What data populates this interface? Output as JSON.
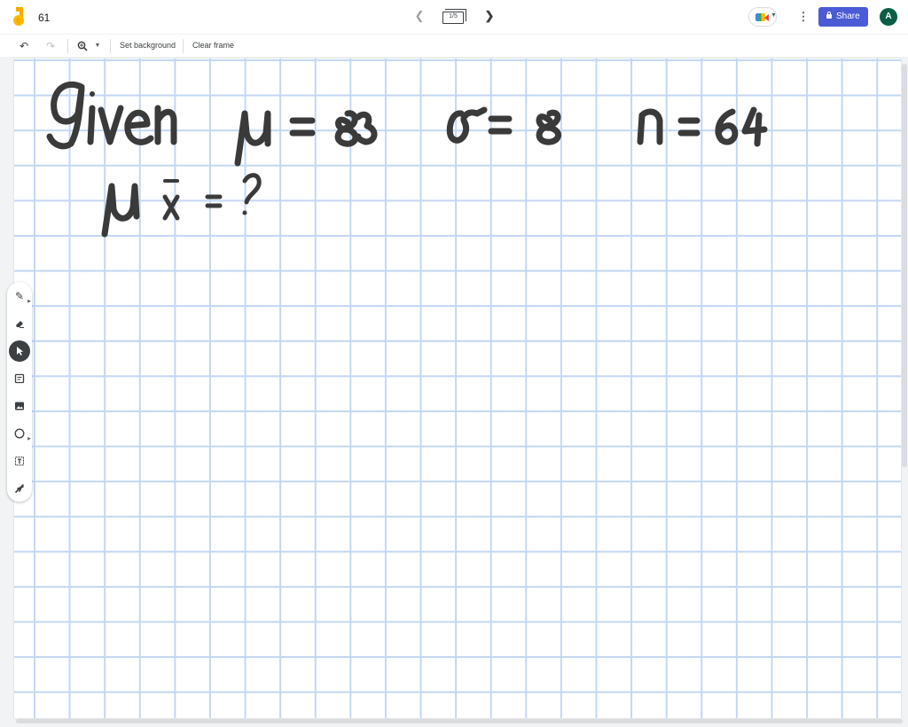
{
  "header": {
    "title": "61",
    "frame_counter": "1/5",
    "share_label": "Share",
    "avatar_initial": "A"
  },
  "toolbar": {
    "set_background_label": "Set background",
    "clear_frame_label": "Clear frame"
  },
  "left_tools": [
    "pen",
    "eraser",
    "select",
    "sticky-note",
    "image",
    "shape",
    "text-box",
    "laser"
  ],
  "whiteboard": {
    "handwriting_line1": "Given: μ = 83   σ = 8   n = 64",
    "handwriting_line2": "μx̄ = ?",
    "ink_color": "#3a3a3a",
    "grid_color": "#c3d7f2"
  },
  "colors": {
    "share_button": "#4b5bd6",
    "avatar": "#0b5e46"
  }
}
